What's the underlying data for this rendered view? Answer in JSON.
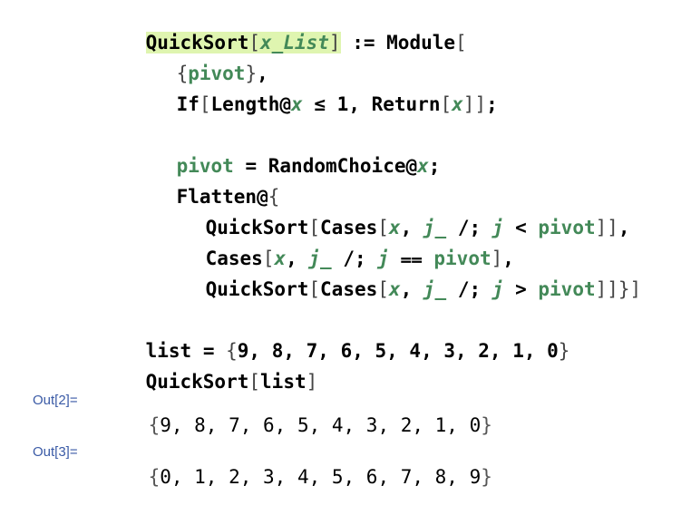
{
  "code": {
    "quicksort": "QuickSort",
    "x_list": "x_List",
    "set_delayed": ":=",
    "module": "Module",
    "pivot": "pivot",
    "if": "If",
    "length": "Length",
    "x": "x",
    "leq": "≤",
    "one": "1",
    "return": "Return",
    "assign": "=",
    "random_choice": "RandomChoice",
    "at": "@",
    "flatten": "Flatten",
    "cases": "Cases",
    "j_pattern": "j_",
    "condition": "/;",
    "j": "j",
    "less": "<",
    "equal": "⩵",
    "greater": ">",
    "list_var": "list",
    "list_values": "9, 8, 7, 6, 5, 4, 3, 2, 1, 0",
    "quicksort_call_arg": "list"
  },
  "outputs": [
    {
      "label": "Out[2]=",
      "value": "9, 8, 7, 6, 5, 4, 3, 2, 1, 0"
    },
    {
      "label": "Out[3]=",
      "value": "0, 1, 2, 3, 4, 5, 6, 7, 8, 9"
    }
  ]
}
